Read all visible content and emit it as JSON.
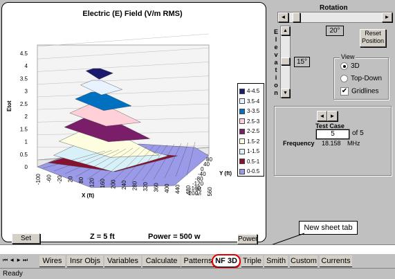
{
  "chart": {
    "title": "Electric (E) Field (V/m RMS)",
    "ylabel": "Etot",
    "xlabel": "X (ft)",
    "zlabel": "Y (ft)",
    "yticks": [
      "4.5",
      "4",
      "3.5",
      "3",
      "2.5",
      "2",
      "1.5",
      "1",
      "0.5",
      "0"
    ],
    "xticks": [
      "-100",
      "-60",
      "-20",
      "20",
      "80",
      "120",
      "160",
      "200",
      "240",
      "280",
      "320",
      "360",
      "400",
      "440",
      "480",
      "520",
      "560"
    ],
    "zticks": [
      "80",
      "40",
      "0",
      "-40",
      "-80",
      "-120",
      "-160",
      "-200"
    ],
    "legend": [
      {
        "label": "4-4.5",
        "color": "#1a1a6e"
      },
      {
        "label": "3.5-4",
        "color": "#e8f3ff"
      },
      {
        "label": "3-3.5",
        "color": "#0070c0"
      },
      {
        "label": "2.5-3",
        "color": "#ffd0d8"
      },
      {
        "label": "2-2.5",
        "color": "#7a1e6a"
      },
      {
        "label": "1.5-2",
        "color": "#fffde0"
      },
      {
        "label": "1-1.5",
        "color": "#d8f0f8"
      },
      {
        "label": "0.5-1",
        "color": "#8a1030"
      },
      {
        "label": "0-0.5",
        "color": "#9a9ae8"
      }
    ],
    "set_scale_label": "Set Scale",
    "z_info": "Z = 5 ft",
    "power_info": "Power = 500 w",
    "power_button": "Power"
  },
  "rotation": {
    "label": "Rotation",
    "value": "20°",
    "reset_label": "Reset Position"
  },
  "elevation": {
    "label_letters": [
      "E",
      "l",
      "e",
      "v",
      "a",
      "t",
      "i",
      "o",
      "n"
    ],
    "value": "15°"
  },
  "view": {
    "title": "View",
    "option_3d": "3D",
    "option_topdown": "Top-Down",
    "gridlines": "Gridlines",
    "selected": "3D",
    "gridlines_checked": true
  },
  "test_case": {
    "label": "Test Case",
    "value": "5",
    "of_label": "of 5",
    "frequency_label": "Frequency",
    "frequency_value": "18.158",
    "frequency_unit": "MHz"
  },
  "callout": {
    "text": "New sheet tab"
  },
  "tabs": [
    "Wires",
    "Insr Objs",
    "Variables",
    "Calculate",
    "Patterns",
    "NF 3D",
    "Triple",
    "Smith",
    "Custom",
    "Currents"
  ],
  "active_tab": "NF 3D",
  "status": "Ready"
}
